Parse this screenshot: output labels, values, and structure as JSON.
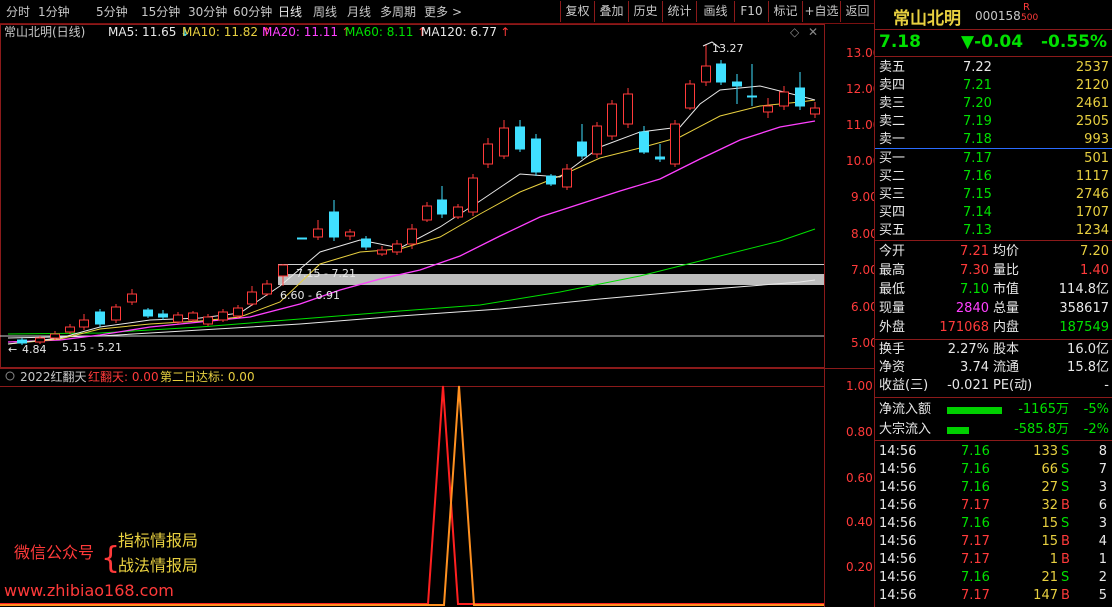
{
  "toolbar": {
    "periods": [
      "分时",
      "1分钟",
      "5分钟",
      "15分钟",
      "30分钟",
      "60分钟",
      "日线",
      "周线",
      "月线",
      "多周期",
      "更多"
    ],
    "active_period": "日线",
    "more_chevron": ">",
    "buttons": [
      "复权",
      "叠加",
      "历史",
      "统计",
      "画线",
      "F10",
      "标记",
      "+自选",
      "返回"
    ]
  },
  "chart": {
    "title": "常山北明(日线)",
    "ma": [
      {
        "label": "MA5: 11.65",
        "arrow": "↓",
        "color": "#e8e8e8",
        "arrow_color": "#40e0ff"
      },
      {
        "label": "MA10: 11.82",
        "arrow": "↑",
        "color": "#e8d040",
        "arrow_color": "#ff3a3a"
      },
      {
        "label": "MA20: 11.11",
        "arrow": "↑",
        "color": "#ff40ff",
        "arrow_color": "#ff3a3a"
      },
      {
        "label": "MA60: 8.11",
        "arrow": "↑",
        "color": "#00e000",
        "arrow_color": "#ff3a3a"
      },
      {
        "label": "MA120: 6.77",
        "arrow": "↑",
        "color": "#e8e8e8",
        "arrow_color": "#ff3a3a"
      }
    ],
    "price_axis": [
      "13.00",
      "12.00",
      "11.00",
      "10.00",
      "9.00",
      "8.00",
      "7.00",
      "6.00",
      "5.00"
    ],
    "annotations": {
      "high": "13.27",
      "low": "4.84",
      "box_top": "7.15 - 7.21",
      "box_bottom": "6.60 - 6.91",
      "low_range": "5.15 - 5.21"
    },
    "indicator_title": "2022红翻天",
    "indicator_s1": "红翻天: 0.00",
    "indicator_s2": "第二日达标: 0.00",
    "indicator_axis": [
      "1.00",
      "0.80",
      "0.60",
      "0.40",
      "0.20"
    ],
    "watermark": {
      "wechat": "微信公众号",
      "brace": "{",
      "line1": "指标情报局",
      "line2": "战法情报局",
      "url": "www.zhibiao168.com"
    }
  },
  "stock": {
    "name": "常山北明",
    "code": "000158",
    "badge_r": "R",
    "badge_num": "500",
    "price": "7.18",
    "change": "▼-0.04",
    "change_pct": "-0.55%"
  },
  "asks": [
    {
      "label": "卖五",
      "price": "7.22",
      "vol": "2537"
    },
    {
      "label": "卖四",
      "price": "7.21",
      "vol": "2120"
    },
    {
      "label": "卖三",
      "price": "7.20",
      "vol": "2461"
    },
    {
      "label": "卖二",
      "price": "7.19",
      "vol": "2505"
    },
    {
      "label": "卖一",
      "price": "7.18",
      "vol": "993"
    }
  ],
  "bids": [
    {
      "label": "买一",
      "price": "7.17",
      "vol": "501"
    },
    {
      "label": "买二",
      "price": "7.16",
      "vol": "1117"
    },
    {
      "label": "买三",
      "price": "7.15",
      "vol": "2746"
    },
    {
      "label": "买四",
      "price": "7.14",
      "vol": "1707"
    },
    {
      "label": "买五",
      "price": "7.13",
      "vol": "1234"
    }
  ],
  "stats": {
    "open_l": "今开",
    "open": "7.21",
    "avg_l": "均价",
    "avg": "7.20",
    "high_l": "最高",
    "high": "7.30",
    "vr_l": "量比",
    "vr": "1.40",
    "low_l": "最低",
    "low": "7.10",
    "mcap_l": "市值",
    "mcap": "114.8亿",
    "cur_l": "现量",
    "cur": "2840",
    "tot_l": "总量",
    "tot": "358617",
    "out_l": "外盘",
    "out": "171068",
    "in_l": "内盘",
    "in": "187549",
    "turn_l": "换手",
    "turn": "2.27%",
    "cap_l": "股本",
    "cap": "16.0亿",
    "na_l": "净资",
    "na": "3.74",
    "float_l": "流通",
    "float": "15.8亿",
    "eps_l": "收益(三)",
    "eps": "-0.021",
    "pe_l": "PE(动)",
    "pe": "-"
  },
  "flows": [
    {
      "label": "净流入额",
      "amount": "-1165万",
      "pct": "-5%",
      "bar": 0.55
    },
    {
      "label": "大宗流入",
      "amount": "-585.8万",
      "pct": "-2%",
      "bar": 0.22
    }
  ],
  "ticks": [
    {
      "time": "14:56",
      "price": "7.16",
      "vol": "133",
      "side": "S",
      "n": "8"
    },
    {
      "time": "14:56",
      "price": "7.16",
      "vol": "66",
      "side": "S",
      "n": "7"
    },
    {
      "time": "14:56",
      "price": "7.16",
      "vol": "27",
      "side": "S",
      "n": "3"
    },
    {
      "time": "14:56",
      "price": "7.17",
      "vol": "32",
      "side": "B",
      "n": "6"
    },
    {
      "time": "14:56",
      "price": "7.16",
      "vol": "15",
      "side": "S",
      "n": "3"
    },
    {
      "time": "14:56",
      "price": "7.17",
      "vol": "15",
      "side": "B",
      "n": "4"
    },
    {
      "time": "14:56",
      "price": "7.17",
      "vol": "1",
      "side": "B",
      "n": "1"
    },
    {
      "time": "14:56",
      "price": "7.16",
      "vol": "21",
      "side": "S",
      "n": "2"
    },
    {
      "time": "14:56",
      "price": "7.17",
      "vol": "147",
      "side": "B",
      "n": "5"
    }
  ],
  "colors": {
    "up": "#ff3a3a",
    "down": "#40e0ff",
    "border": "#8b1a1a",
    "flat": "#e8e8e8"
  }
}
